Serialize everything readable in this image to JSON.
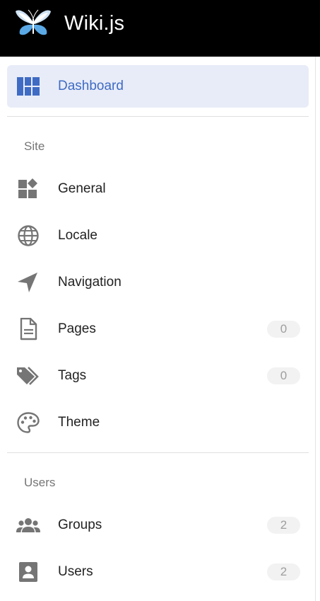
{
  "app": {
    "title": "Wiki.js"
  },
  "nav": {
    "dashboard": {
      "label": "Dashboard",
      "icon": "dashboard-icon"
    },
    "sections": [
      {
        "label": "Site",
        "items": [
          {
            "label": "General",
            "icon": "widgets-icon"
          },
          {
            "label": "Locale",
            "icon": "globe-icon"
          },
          {
            "label": "Navigation",
            "icon": "navigation-arrow-icon"
          },
          {
            "label": "Pages",
            "icon": "document-icon",
            "badge": "0"
          },
          {
            "label": "Tags",
            "icon": "tags-icon",
            "badge": "0"
          },
          {
            "label": "Theme",
            "icon": "palette-icon"
          }
        ]
      },
      {
        "label": "Users",
        "items": [
          {
            "label": "Groups",
            "icon": "groups-icon",
            "badge": "2"
          },
          {
            "label": "Users",
            "icon": "user-card-icon",
            "badge": "2"
          }
        ]
      }
    ]
  },
  "colors": {
    "header_bg": "#000000",
    "active_bg": "#e8ecf8",
    "active_text": "#3f6bc4",
    "icon_gray": "#757575",
    "badge_bg": "#f2f2f2"
  }
}
